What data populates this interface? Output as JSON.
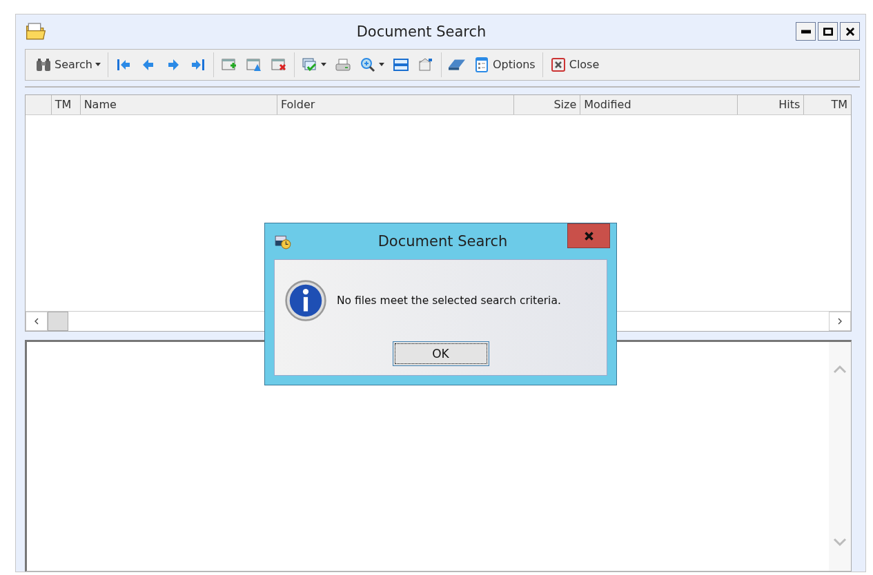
{
  "window": {
    "title": "Document Search"
  },
  "toolbar": {
    "groups": [
      [
        {
          "kind": "labeled",
          "label": "Search",
          "dropdown": true
        }
      ],
      [
        {
          "kind": "plain",
          "dropdown": false
        },
        {
          "kind": "plain",
          "dropdown": false
        },
        {
          "kind": "plain",
          "dropdown": false
        },
        {
          "kind": "plain",
          "dropdown": false
        }
      ],
      [
        {
          "kind": "plain",
          "dropdown": false
        },
        {
          "kind": "plain",
          "dropdown": false
        },
        {
          "kind": "plain",
          "dropdown": false
        }
      ],
      [
        {
          "kind": "plain",
          "dropdown": true
        },
        {
          "kind": "plain",
          "dropdown": false
        },
        {
          "kind": "plain",
          "dropdown": true
        },
        {
          "kind": "plain",
          "dropdown": false
        },
        {
          "kind": "plain",
          "dropdown": false
        }
      ],
      [
        {
          "kind": "plain",
          "dropdown": false
        },
        {
          "kind": "labeled",
          "label": "Options",
          "dropdown": false
        }
      ],
      [
        {
          "kind": "labeled",
          "label": "Close",
          "dropdown": false
        }
      ]
    ]
  },
  "results": {
    "columns": [
      {},
      {
        "label": "TM"
      },
      {
        "label": "Name"
      },
      {
        "label": "Folder"
      },
      {
        "label": "Size"
      },
      {
        "label": "Modified"
      },
      {
        "label": "Hits"
      },
      {
        "label": "TM"
      }
    ]
  },
  "dialog": {
    "title": "Document Search",
    "message": "No files meet the selected search criteria.",
    "button": {
      "label": "OK",
      "focused": true
    }
  }
}
